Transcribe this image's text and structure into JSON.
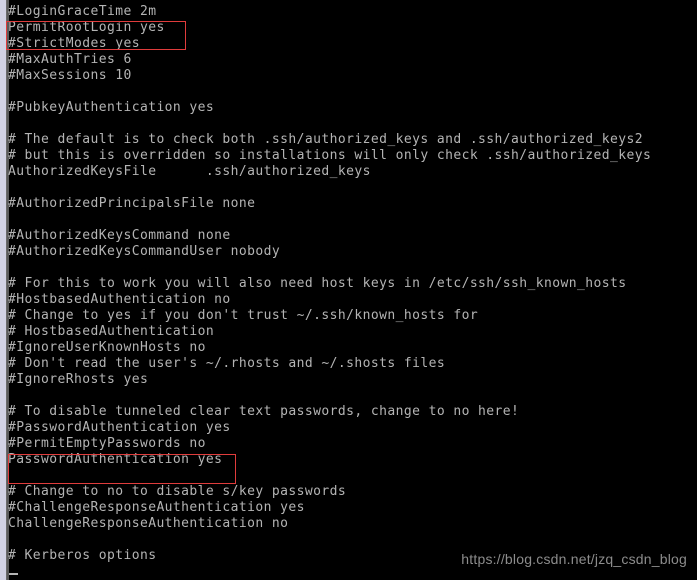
{
  "window": {
    "kind": "terminal-text-editor",
    "background_color": "#000000",
    "text_color": "#b4b4b4",
    "highlight_color": "#e03c3c",
    "scrollbar_color": "#c8c8dc"
  },
  "file": {
    "lines": [
      "#LoginGraceTime 2m",
      "PermitRootLogin yes",
      "#StrictModes yes",
      "#MaxAuthTries 6",
      "#MaxSessions 10",
      "",
      "#PubkeyAuthentication yes",
      "",
      "# The default is to check both .ssh/authorized_keys and .ssh/authorized_keys2",
      "# but this is overridden so installations will only check .ssh/authorized_keys",
      "AuthorizedKeysFile      .ssh/authorized_keys",
      "",
      "#AuthorizedPrincipalsFile none",
      "",
      "#AuthorizedKeysCommand none",
      "#AuthorizedKeysCommandUser nobody",
      "",
      "# For this to work you will also need host keys in /etc/ssh/ssh_known_hosts",
      "#HostbasedAuthentication no",
      "# Change to yes if you don't trust ~/.ssh/known_hosts for",
      "# HostbasedAuthentication",
      "#IgnoreUserKnownHosts no",
      "# Don't read the user's ~/.rhosts and ~/.shosts files",
      "#IgnoreRhosts yes",
      "",
      "# To disable tunneled clear text passwords, change to no here!",
      "#PasswordAuthentication yes",
      "#PermitEmptyPasswords no",
      "PasswordAuthentication yes",
      "",
      "# Change to no to disable s/key passwords",
      "#ChallengeResponseAuthentication yes",
      "ChallengeResponseAuthentication no",
      "",
      "# Kerberos options"
    ]
  },
  "annotations": {
    "boxes": [
      {
        "id": "permit-root-login",
        "label": "PermitRootLogin yes"
      },
      {
        "id": "password-authentication",
        "label": "PasswordAuthentication yes"
      }
    ]
  },
  "cursor": {
    "line_index": 34,
    "column": 1
  },
  "watermark": {
    "text": "https://blog.csdn.net/jzq_csdn_blog"
  }
}
